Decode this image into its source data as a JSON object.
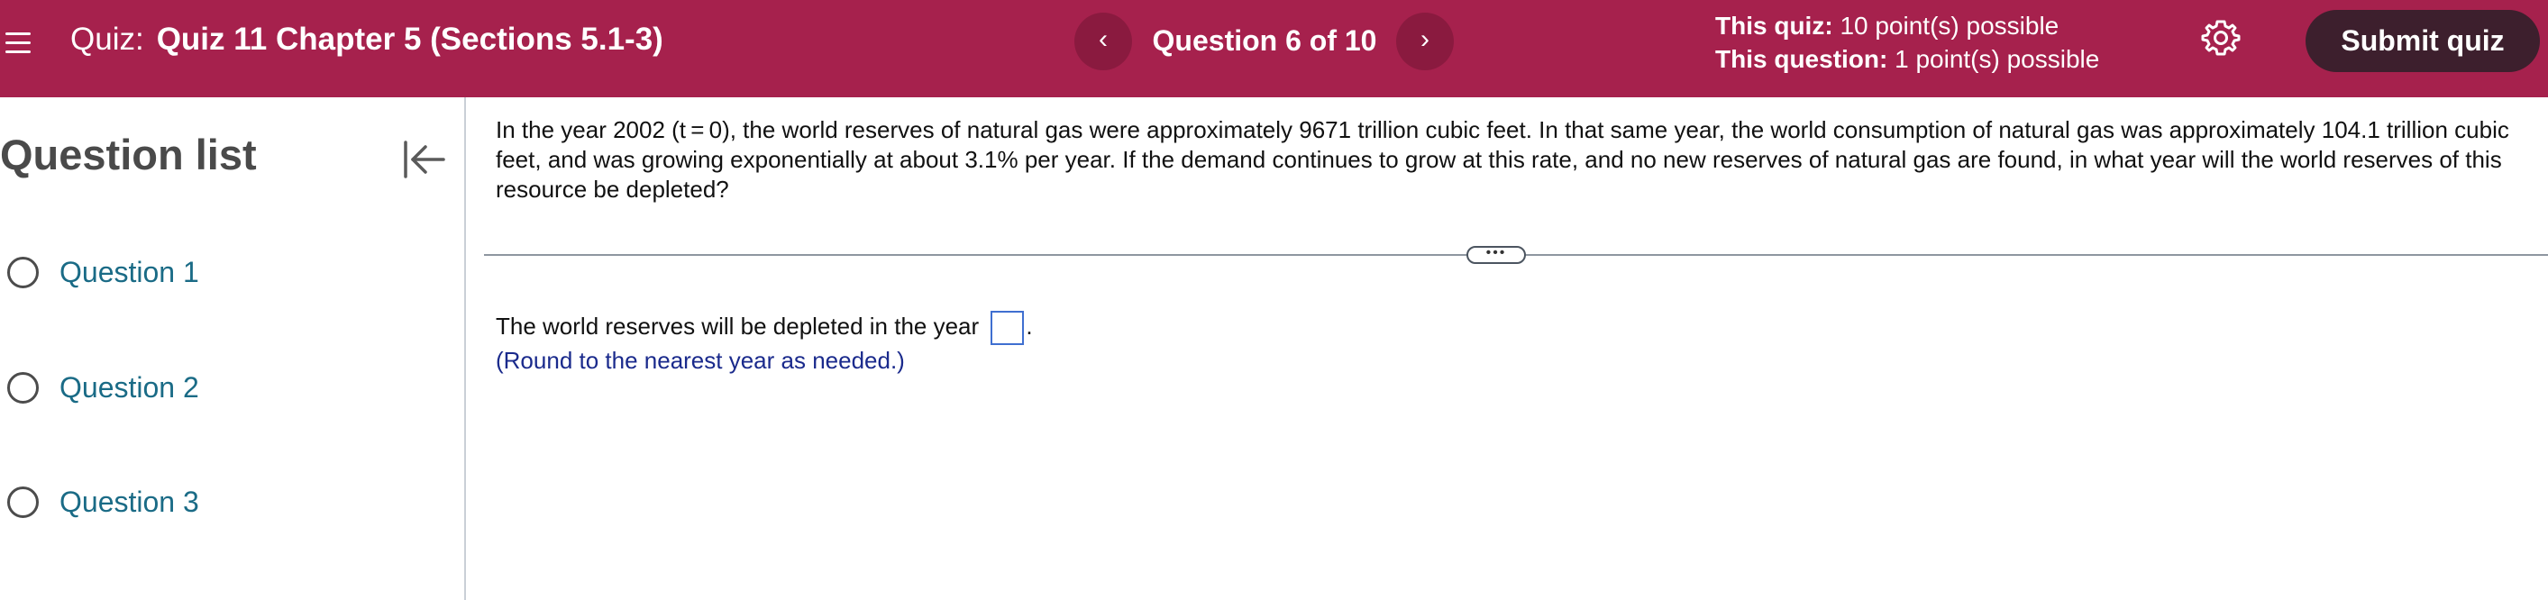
{
  "header": {
    "quiz_prefix": "Quiz:",
    "quiz_name": "Quiz 11 Chapter 5 (Sections 5.1-3)",
    "prev_label": "‹",
    "next_label": "›",
    "question_counter": "Question 6 of 10",
    "this_quiz_label": "This quiz:",
    "this_quiz_value": "10 point(s) possible",
    "this_question_label": "This question:",
    "this_question_value": "1 point(s) possible",
    "submit_label": "Submit quiz",
    "bar_color": "#a6214d",
    "submit_color": "#3d1f2d"
  },
  "sidebar": {
    "title": "Question list",
    "items": [
      {
        "label": "Question 1"
      },
      {
        "label": "Question 2"
      },
      {
        "label": "Question 3"
      }
    ]
  },
  "main": {
    "question_text": "In the year 2002 (t = 0), the world reserves of natural gas were approximately 9671 trillion cubic feet. In that same year, the world consumption of natural gas was approximately 104.1 trillion cubic feet, and was growing exponentially at about 3.1% per year. If the demand continues to grow at this rate, and no new reserves of natural gas are found, in what year will the world reserves of this resource be depleted?",
    "handle_label": "•••",
    "answer_prefix": "The world reserves will be depleted in the year",
    "answer_value": "",
    "answer_suffix": ".",
    "round_hint": "(Round to the nearest year as needed.)"
  },
  "icons": {
    "menu": "hamburger-menu-icon",
    "settings": "gear-icon",
    "collapse": "collapse-left-icon",
    "radio": "radio-unchecked-icon"
  }
}
